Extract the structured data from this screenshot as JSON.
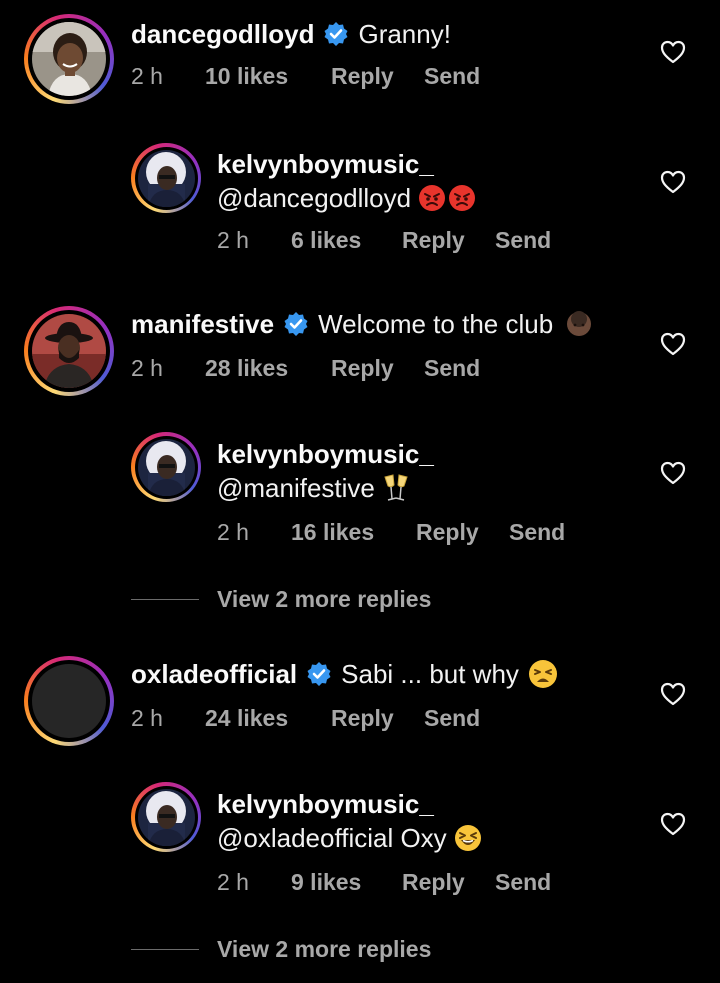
{
  "comments": [
    {
      "username": "dancegodlloyd",
      "verified": true,
      "text": "Granny!",
      "time": "2 h",
      "likes": "10 likes",
      "reply": "Reply",
      "send": "Send",
      "emojis": []
    },
    {
      "username": "kelvynboymusic_",
      "verified": false,
      "text": "@dancegodlloyd",
      "time": "2 h",
      "likes": "6 likes",
      "reply": "Reply",
      "send": "Send",
      "emojis": [
        "angry-face-emoji",
        "angry-face-emoji"
      ]
    },
    {
      "username": "manifestive",
      "verified": true,
      "text": "Welcome to the club",
      "time": "2 h",
      "likes": "28 likes",
      "reply": "Reply",
      "send": "Send",
      "emojis": [
        "dark-skin-face-emoji"
      ]
    },
    {
      "username": "kelvynboymusic_",
      "verified": false,
      "text": "@manifestive",
      "time": "2 h",
      "likes": "16 likes",
      "reply": "Reply",
      "send": "Send",
      "emojis": [
        "clinking-glasses-emoji"
      ]
    },
    {
      "username": "oxladeofficial",
      "verified": true,
      "text": "Sabi ... but why",
      "time": "2 h",
      "likes": "24 likes",
      "reply": "Reply",
      "send": "Send",
      "emojis": [
        "tired-face-emoji"
      ]
    },
    {
      "username": "kelvynboymusic_",
      "verified": false,
      "text": "@oxladeofficial Oxy",
      "time": "2 h",
      "likes": "9 likes",
      "reply": "Reply",
      "send": "Send",
      "emojis": [
        "laughing-squint-emoji"
      ]
    }
  ],
  "view_more": [
    "View 2 more replies",
    "View 2 more replies"
  ],
  "colors": {
    "background": "#000000",
    "verified_blue": "#3897f0",
    "meta_gray": "#a8a8a8"
  }
}
